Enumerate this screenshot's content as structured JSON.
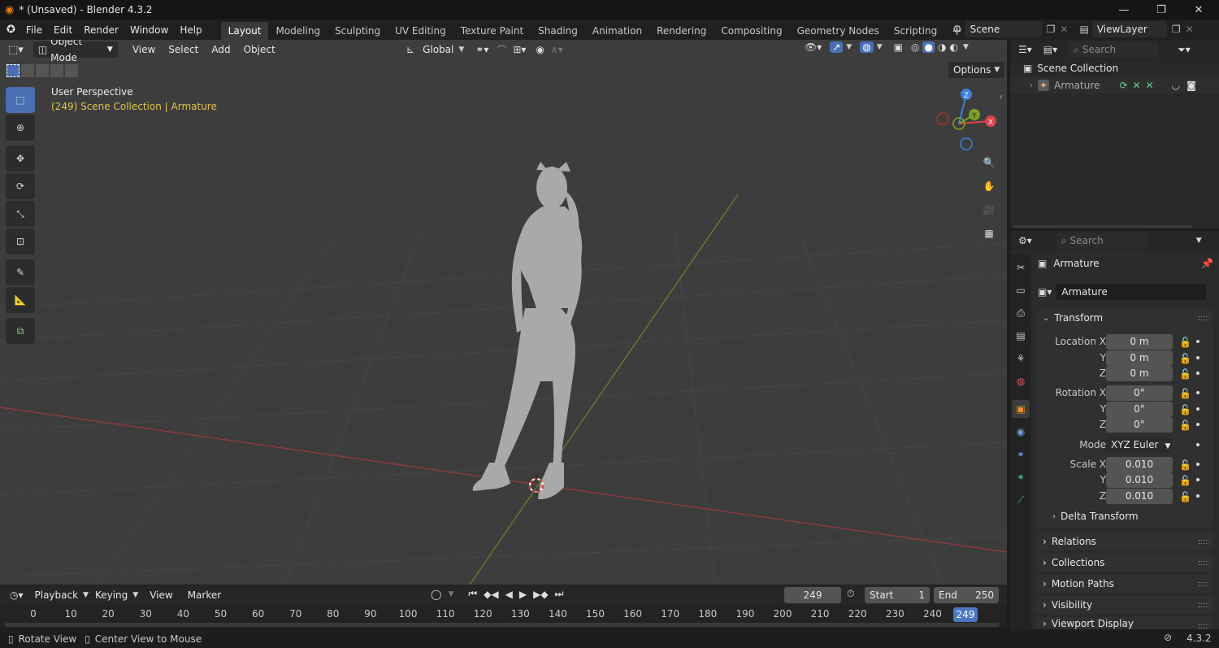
{
  "window": {
    "title": "* (Unsaved) - Blender 4.3.2",
    "minimize": "—",
    "maximize": "❐",
    "close": "✕"
  },
  "menubar": {
    "items": [
      "File",
      "Edit",
      "Render",
      "Window",
      "Help"
    ],
    "workspaces": [
      "Layout",
      "Modeling",
      "Sculpting",
      "UV Editing",
      "Texture Paint",
      "Shading",
      "Animation",
      "Rendering",
      "Compositing",
      "Geometry Nodes",
      "Scripting"
    ],
    "add_tab": "+",
    "scene": "Scene",
    "view_layer": "ViewLayer"
  },
  "viewport": {
    "mode": "Object Mode",
    "menus": [
      "View",
      "Select",
      "Add",
      "Object"
    ],
    "orientation": "Global",
    "options": "Options",
    "perspective": "User Perspective",
    "context": "(249) Scene Collection | Armature",
    "gizmo": {
      "x": "X",
      "y": "Y",
      "z": "Z"
    }
  },
  "timeline": {
    "menus": [
      "Playback",
      "Keying",
      "View",
      "Marker"
    ],
    "current_frame": "249",
    "start_label": "Start",
    "start_value": "1",
    "end_label": "End",
    "end_value": "250",
    "ruler": [
      "0",
      "10",
      "20",
      "30",
      "40",
      "50",
      "60",
      "70",
      "80",
      "90",
      "100",
      "110",
      "120",
      "130",
      "140",
      "150",
      "160",
      "170",
      "180",
      "190",
      "200",
      "210",
      "220",
      "230",
      "240"
    ],
    "playhead": "249"
  },
  "status": {
    "left1": "Rotate View",
    "left2": "Center View to Mouse",
    "version": "4.3.2"
  },
  "outliner": {
    "search_placeholder": "Search",
    "root": "Scene Collection",
    "item": "Armature"
  },
  "properties": {
    "search_placeholder": "Search",
    "object_name": "Armature",
    "data_name": "Armature",
    "transform_header": "Transform",
    "location_label": "Location X",
    "rotation_label": "Rotation X",
    "scale_label": "Scale X",
    "y_label": "Y",
    "z_label": "Z",
    "location": [
      "0 m",
      "0 m",
      "0 m"
    ],
    "rotation": [
      "0°",
      "0°",
      "0°"
    ],
    "mode_label": "Mode",
    "mode_value": "XYZ Euler",
    "scale": [
      "0.010",
      "0.010",
      "0.010"
    ],
    "delta_transform": "Delta Transform",
    "sections": [
      "Relations",
      "Collections",
      "Motion Paths",
      "Visibility",
      "Viewport Display"
    ]
  },
  "colors": {
    "accent": "#4a6fb3",
    "x_axis": "#d7434f",
    "y_axis": "#7aa22a",
    "z_axis": "#3d7ee0",
    "playhead": "#4a78c2",
    "context_text": "#e0c44a"
  }
}
